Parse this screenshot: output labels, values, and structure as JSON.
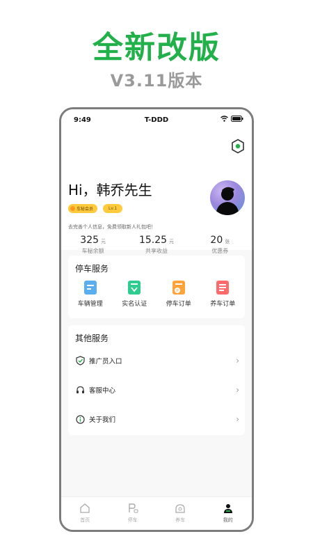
{
  "promo": {
    "title": "全新改版",
    "subtitle": "V3.11版本"
  },
  "status_bar": {
    "time": "9:49",
    "carrier": "T-DDD"
  },
  "profile": {
    "greeting": "Hi，韩乔先生",
    "badges": {
      "vip": "车秘会员",
      "level": "Lv.1"
    },
    "invite_text": "去完善个人信息，免费领取新人礼包吧！",
    "stats": [
      {
        "value": "325",
        "unit": "元",
        "label": "车秘余额"
      },
      {
        "value": "15.25",
        "unit": "元",
        "label": "共享收益"
      },
      {
        "value": "20",
        "unit": "张",
        "label": "优惠券"
      }
    ]
  },
  "parking_services": {
    "title": "停车服务",
    "items": [
      {
        "label": "车辆管理",
        "icon": "vehicle-card-icon",
        "color": "#5aaef0"
      },
      {
        "label": "实名认证",
        "icon": "verify-card-icon",
        "color": "#2ecc8f"
      },
      {
        "label": "停车订单",
        "icon": "parking-order-icon",
        "color": "#ffa33a"
      },
      {
        "label": "养车订单",
        "icon": "care-order-icon",
        "color": "#ff6b6b"
      }
    ]
  },
  "other_services": {
    "title": "其他服务",
    "items": [
      {
        "label": "推广员入口",
        "icon": "shield-check-icon"
      },
      {
        "label": "客服中心",
        "icon": "headset-icon"
      },
      {
        "label": "关于我们",
        "icon": "info-icon"
      }
    ]
  },
  "tabbar": {
    "items": [
      {
        "label": "首页",
        "icon": "home-icon"
      },
      {
        "label": "停车",
        "icon": "parking-icon"
      },
      {
        "label": "养车",
        "icon": "car-care-icon"
      },
      {
        "label": "我的",
        "icon": "profile-icon",
        "active": true
      }
    ]
  },
  "colors": {
    "brand_green": "#22b04b",
    "badge_yellow": "#ffcb3d",
    "promo_gray": "#9a9a9a"
  }
}
